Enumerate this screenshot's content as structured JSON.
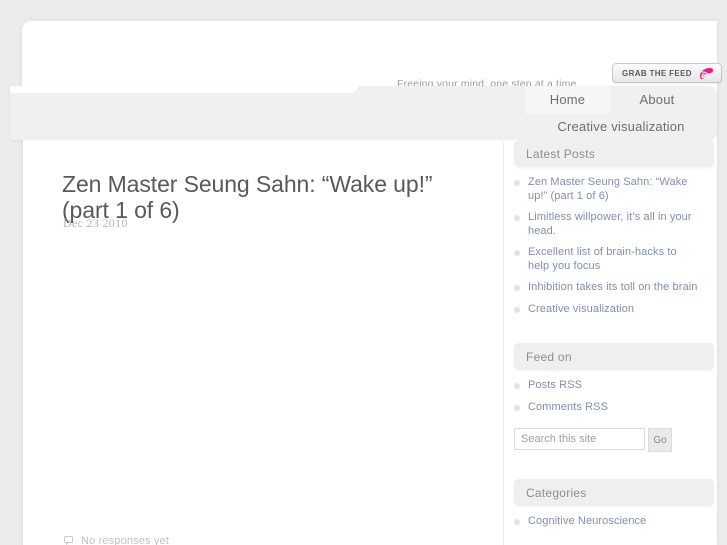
{
  "site": {
    "tagline": "Freeing your mind, one step at a time",
    "logo_placeholder": "broken-image",
    "feed_button_label": "GRAB THE FEED"
  },
  "nav": {
    "items": [
      {
        "label": "Home",
        "active": true
      },
      {
        "label": "About",
        "active": false
      },
      {
        "label": "Creative visualization",
        "active": false
      }
    ]
  },
  "post": {
    "title": "Zen Master Seung Sahn: “Wake up!” (part 1 of 6)",
    "date": "Dec 23 2010",
    "responses": "No responses yet"
  },
  "sidebar": {
    "latest_posts": {
      "heading": "Latest Posts",
      "items": [
        "Zen Master Seung Sahn: “Wake up!” (part 1 of 6)",
        "Limitless willpower, it’s all in your head.",
        "Excellent list of brain-hacks to help you focus",
        "Inhibition takes its toll on the brain",
        "Creative visualization"
      ]
    },
    "feed_on": {
      "heading": "Feed on",
      "items": [
        "Posts RSS",
        "Comments RSS"
      ]
    },
    "search": {
      "placeholder": "Search this site",
      "value": "",
      "button_label": "Go"
    },
    "categories": {
      "heading": "Categories",
      "items": [
        "Cognitive Neuroscience"
      ]
    }
  },
  "colors": {
    "page_background": "#ececec",
    "card_background": "#ffffff",
    "nav_band": "#f0f0f0",
    "widget_header": "#efefef",
    "link": "#7f8fae",
    "title_text": "#595959",
    "feed_icon": "#f5197f"
  }
}
